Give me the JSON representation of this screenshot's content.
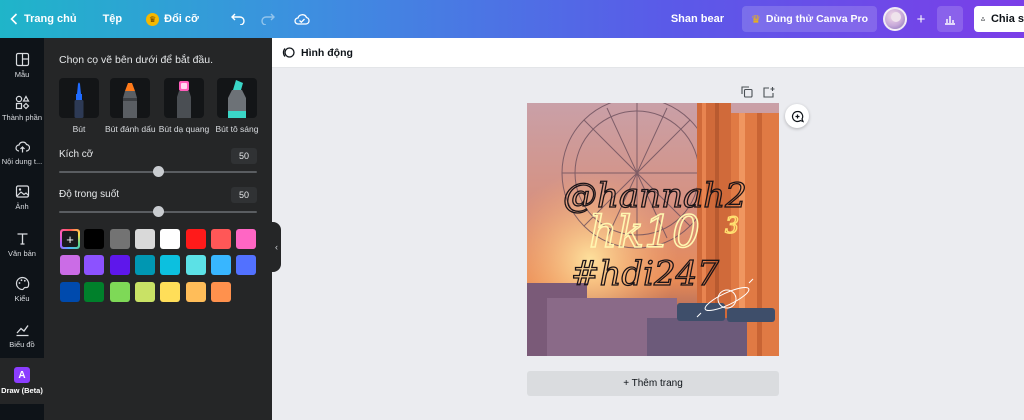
{
  "topbar": {
    "home_label": "Trang chủ",
    "file_label": "Tệp",
    "resize_label": "Đổi cỡ",
    "user_name": "Shan bear",
    "pro_label": "Dùng thử Canva Pro",
    "share_label": "Chia s"
  },
  "rail": {
    "items": [
      {
        "label": "Mẫu",
        "icon": "template-icon"
      },
      {
        "label": "Thành phần",
        "icon": "shapes-icon"
      },
      {
        "label": "Nội dung t...",
        "icon": "cloud-upload-icon"
      },
      {
        "label": "Ảnh",
        "icon": "image-icon"
      },
      {
        "label": "Văn bản",
        "icon": "text-icon"
      },
      {
        "label": "Kiểu",
        "icon": "palette-icon"
      },
      {
        "label": "Biểu đồ",
        "icon": "chart-icon"
      },
      {
        "label": "Draw (Beta)",
        "icon": "draw-icon",
        "badge": "A"
      }
    ]
  },
  "panel": {
    "hint": "Chọn cọ vẽ bên dưới để bắt đầu.",
    "pens": [
      {
        "label": "Bút",
        "tip_color": "#1f6bff"
      },
      {
        "label": "Bút đánh dấu",
        "tip_color": "#ff7a1a"
      },
      {
        "label": "Bút dạ quang",
        "tip_color": "#ff5dbb"
      },
      {
        "label": "Bút tô sáng",
        "tip_color": "#3ad6c7"
      }
    ],
    "size_label": "Kích cỡ",
    "size_value": "50",
    "size_level": 0.5,
    "opacity_label": "Độ trong suốt",
    "opacity_value": "50",
    "opacity_level": 0.5,
    "colors": [
      [
        "#000000",
        "#737373",
        "#d9d9d9",
        "#ffffff",
        "#ff1a1a",
        "#ff5757",
        "#ff66c4"
      ],
      [
        "#cb6ce6",
        "#8c52ff",
        "#5e17eb",
        "#0097b2",
        "#0cc0df",
        "#5ce1e6",
        "#38b6ff",
        "#5271ff"
      ],
      [
        "#004aad",
        "#00802b",
        "#7ed957",
        "#c9e265",
        "#ffde59",
        "#ffbd59",
        "#ff914d"
      ]
    ]
  },
  "editor": {
    "animate_label": "Hình động",
    "add_page_label": "+ Thêm trang"
  },
  "design": {
    "handwriting": [
      "@hannah2",
      "hk10",
      "3",
      "#hdi247"
    ]
  }
}
